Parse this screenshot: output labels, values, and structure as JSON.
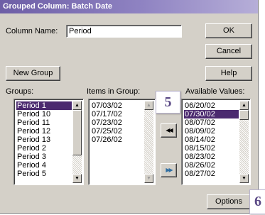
{
  "window": {
    "title": "Grouped Column: Batch Date"
  },
  "column_name": {
    "label": "Column Name:",
    "value": "Period"
  },
  "buttons": {
    "ok": "OK",
    "cancel": "Cancel",
    "new_group": "New Group",
    "help": "Help",
    "options": "Options",
    "move_left": "◀◀",
    "move_right": "▶▶"
  },
  "groups": {
    "label": "Groups:",
    "items": [
      "Period 1",
      "Period 10",
      "Period 11",
      "Period 12",
      "Period 13",
      "Period 2",
      "Period 3",
      "Period 4",
      "Period 5"
    ],
    "selected": "Period 1"
  },
  "items_in_group": {
    "label": "Items in Group:",
    "items": [
      "07/03/02",
      "07/17/02",
      "07/23/02",
      "07/25/02",
      "07/26/02"
    ]
  },
  "available_values": {
    "label": "Available Values:",
    "items": [
      "06/20/02",
      "07/30/02",
      "08/07/02",
      "08/09/02",
      "08/14/02",
      "08/15/02",
      "08/23/02",
      "08/26/02",
      "08/27/02"
    ],
    "selected": "07/30/02"
  },
  "callouts": {
    "five": "5",
    "six": "6"
  },
  "colors": {
    "selection": "#4b2a6f",
    "title_bar": "#6d5ea6",
    "callout_text": "#5b4a86",
    "dialog_bg": "#d4d0c8"
  }
}
